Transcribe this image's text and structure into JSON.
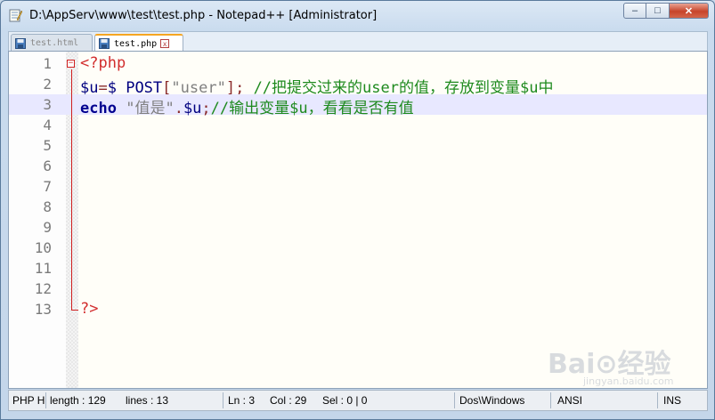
{
  "window": {
    "title": "D:\\AppServ\\www\\test\\test.php - Notepad++ [Administrator]",
    "controls": {
      "minimize": "–",
      "maximize": "□",
      "close": "✕"
    }
  },
  "tabs": [
    {
      "label": "test.html",
      "active": false
    },
    {
      "label": "test.php",
      "active": true,
      "close": "x"
    }
  ],
  "editor": {
    "line_numbers": [
      "1",
      "2",
      "3",
      "4",
      "5",
      "6",
      "7",
      "8",
      "9",
      "10",
      "11",
      "12",
      "13"
    ],
    "current_line": 3,
    "fold_marker": "−",
    "lines": {
      "l1": {
        "open_tag": "<?php"
      },
      "l2": {
        "var": "$u",
        "op": "=",
        "post": "$_POST",
        "bracket_open": "[",
        "key": "\"user\"",
        "bracket_close": "]",
        "semicolon": ";",
        "comment": " //把提交过来的user的值，存放到变量$u中"
      },
      "l3": {
        "keyword": "echo",
        "space": " ",
        "string": "\"值是\"",
        "dot": ".",
        "var": "$u",
        "semicolon": ";",
        "comment": "//输出变量$u，看看是否有值"
      },
      "l13": {
        "close_tag": "?>"
      }
    }
  },
  "statusbar": {
    "file_type": "PHP H",
    "length": "length : 129",
    "lines": "lines : 13",
    "ln": "Ln : 3",
    "col": "Col : 29",
    "sel": "Sel : 0 | 0",
    "eol": "Dos\\Windows",
    "encoding": "ANSI",
    "mode": "INS"
  },
  "watermark": {
    "main": "Bai⊙经验",
    "sub": "jingyan.baidu.com"
  },
  "colors": {
    "php_tag": "#d22e2e",
    "variable": "#000080",
    "string": "#808080",
    "comment": "#1e8a1e",
    "keyword": "#000090",
    "current_line_bg": "#e8e8ff",
    "active_tab_accent": "#f5a623"
  }
}
